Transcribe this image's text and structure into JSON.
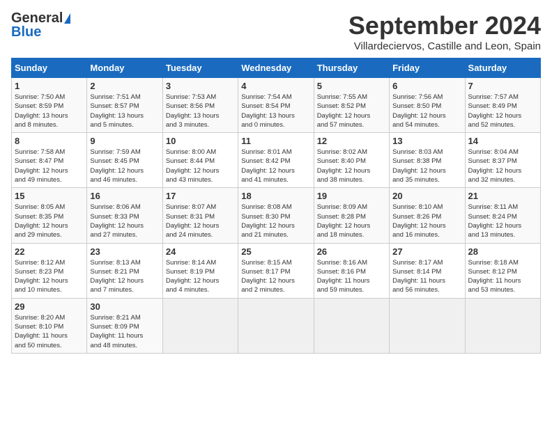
{
  "header": {
    "logo_general": "General",
    "logo_blue": "Blue",
    "title": "September 2024",
    "subtitle": "Villardeciervos, Castille and Leon, Spain"
  },
  "calendar": {
    "headers": [
      "Sunday",
      "Monday",
      "Tuesday",
      "Wednesday",
      "Thursday",
      "Friday",
      "Saturday"
    ],
    "weeks": [
      [
        {
          "day": "1",
          "info": "Sunrise: 7:50 AM\nSunset: 8:59 PM\nDaylight: 13 hours\nand 8 minutes."
        },
        {
          "day": "2",
          "info": "Sunrise: 7:51 AM\nSunset: 8:57 PM\nDaylight: 13 hours\nand 5 minutes."
        },
        {
          "day": "3",
          "info": "Sunrise: 7:53 AM\nSunset: 8:56 PM\nDaylight: 13 hours\nand 3 minutes."
        },
        {
          "day": "4",
          "info": "Sunrise: 7:54 AM\nSunset: 8:54 PM\nDaylight: 13 hours\nand 0 minutes."
        },
        {
          "day": "5",
          "info": "Sunrise: 7:55 AM\nSunset: 8:52 PM\nDaylight: 12 hours\nand 57 minutes."
        },
        {
          "day": "6",
          "info": "Sunrise: 7:56 AM\nSunset: 8:50 PM\nDaylight: 12 hours\nand 54 minutes."
        },
        {
          "day": "7",
          "info": "Sunrise: 7:57 AM\nSunset: 8:49 PM\nDaylight: 12 hours\nand 52 minutes."
        }
      ],
      [
        {
          "day": "8",
          "info": "Sunrise: 7:58 AM\nSunset: 8:47 PM\nDaylight: 12 hours\nand 49 minutes."
        },
        {
          "day": "9",
          "info": "Sunrise: 7:59 AM\nSunset: 8:45 PM\nDaylight: 12 hours\nand 46 minutes."
        },
        {
          "day": "10",
          "info": "Sunrise: 8:00 AM\nSunset: 8:44 PM\nDaylight: 12 hours\nand 43 minutes."
        },
        {
          "day": "11",
          "info": "Sunrise: 8:01 AM\nSunset: 8:42 PM\nDaylight: 12 hours\nand 41 minutes."
        },
        {
          "day": "12",
          "info": "Sunrise: 8:02 AM\nSunset: 8:40 PM\nDaylight: 12 hours\nand 38 minutes."
        },
        {
          "day": "13",
          "info": "Sunrise: 8:03 AM\nSunset: 8:38 PM\nDaylight: 12 hours\nand 35 minutes."
        },
        {
          "day": "14",
          "info": "Sunrise: 8:04 AM\nSunset: 8:37 PM\nDaylight: 12 hours\nand 32 minutes."
        }
      ],
      [
        {
          "day": "15",
          "info": "Sunrise: 8:05 AM\nSunset: 8:35 PM\nDaylight: 12 hours\nand 29 minutes."
        },
        {
          "day": "16",
          "info": "Sunrise: 8:06 AM\nSunset: 8:33 PM\nDaylight: 12 hours\nand 27 minutes."
        },
        {
          "day": "17",
          "info": "Sunrise: 8:07 AM\nSunset: 8:31 PM\nDaylight: 12 hours\nand 24 minutes."
        },
        {
          "day": "18",
          "info": "Sunrise: 8:08 AM\nSunset: 8:30 PM\nDaylight: 12 hours\nand 21 minutes."
        },
        {
          "day": "19",
          "info": "Sunrise: 8:09 AM\nSunset: 8:28 PM\nDaylight: 12 hours\nand 18 minutes."
        },
        {
          "day": "20",
          "info": "Sunrise: 8:10 AM\nSunset: 8:26 PM\nDaylight: 12 hours\nand 16 minutes."
        },
        {
          "day": "21",
          "info": "Sunrise: 8:11 AM\nSunset: 8:24 PM\nDaylight: 12 hours\nand 13 minutes."
        }
      ],
      [
        {
          "day": "22",
          "info": "Sunrise: 8:12 AM\nSunset: 8:23 PM\nDaylight: 12 hours\nand 10 minutes."
        },
        {
          "day": "23",
          "info": "Sunrise: 8:13 AM\nSunset: 8:21 PM\nDaylight: 12 hours\nand 7 minutes."
        },
        {
          "day": "24",
          "info": "Sunrise: 8:14 AM\nSunset: 8:19 PM\nDaylight: 12 hours\nand 4 minutes."
        },
        {
          "day": "25",
          "info": "Sunrise: 8:15 AM\nSunset: 8:17 PM\nDaylight: 12 hours\nand 2 minutes."
        },
        {
          "day": "26",
          "info": "Sunrise: 8:16 AM\nSunset: 8:16 PM\nDaylight: 11 hours\nand 59 minutes."
        },
        {
          "day": "27",
          "info": "Sunrise: 8:17 AM\nSunset: 8:14 PM\nDaylight: 11 hours\nand 56 minutes."
        },
        {
          "day": "28",
          "info": "Sunrise: 8:18 AM\nSunset: 8:12 PM\nDaylight: 11 hours\nand 53 minutes."
        }
      ],
      [
        {
          "day": "29",
          "info": "Sunrise: 8:20 AM\nSunset: 8:10 PM\nDaylight: 11 hours\nand 50 minutes."
        },
        {
          "day": "30",
          "info": "Sunrise: 8:21 AM\nSunset: 8:09 PM\nDaylight: 11 hours\nand 48 minutes."
        },
        {
          "day": "",
          "info": ""
        },
        {
          "day": "",
          "info": ""
        },
        {
          "day": "",
          "info": ""
        },
        {
          "day": "",
          "info": ""
        },
        {
          "day": "",
          "info": ""
        }
      ]
    ]
  }
}
